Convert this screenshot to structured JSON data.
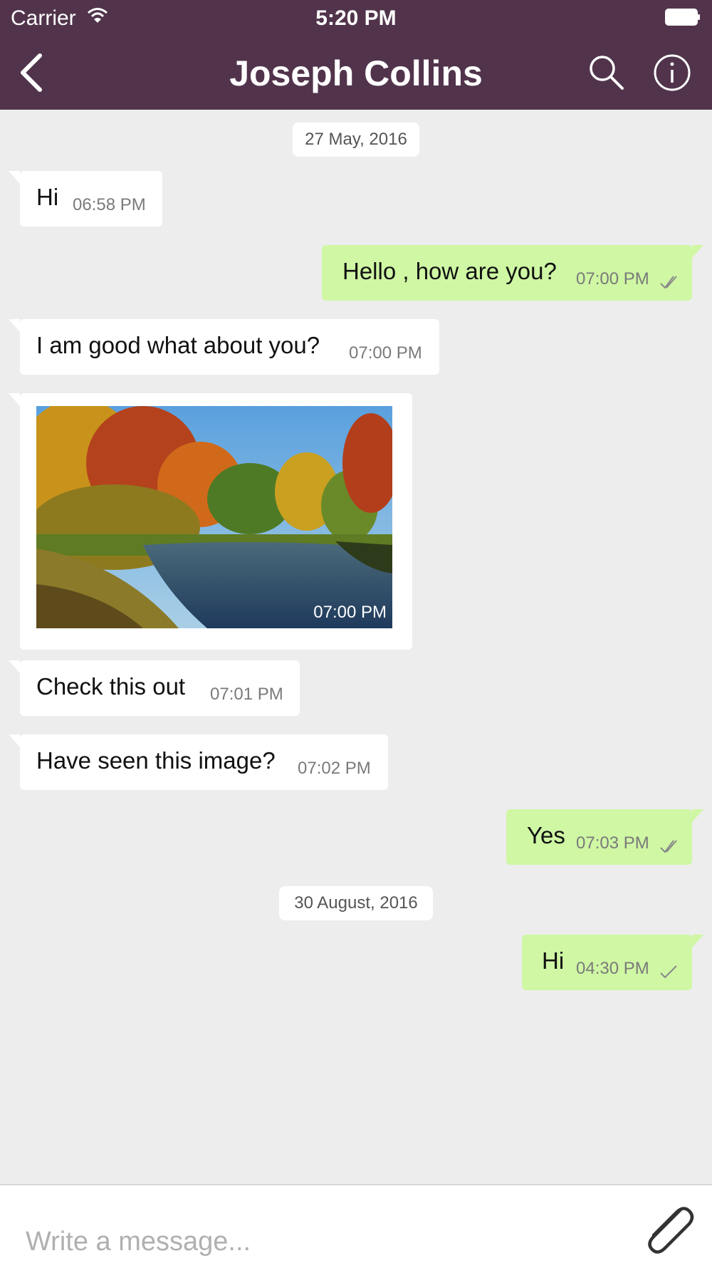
{
  "status_bar": {
    "carrier": "Carrier",
    "time": "5:20 PM"
  },
  "header": {
    "title": "Joseph Collins"
  },
  "icons": {
    "back": "chevron-left-icon",
    "search": "search-icon",
    "info": "info-icon",
    "attach": "paperclip-icon",
    "wifi": "wifi-icon",
    "battery": "battery-icon",
    "read_receipt": "double-check-icon",
    "sent_receipt": "check-icon"
  },
  "colors": {
    "header": "#51344b",
    "outgoing_bubble": "#cff7a4",
    "incoming_bubble": "#ffffff",
    "background": "#ededed"
  },
  "messages": [
    {
      "type": "date",
      "text": "27 May, 2016"
    },
    {
      "type": "in",
      "text": "Hi",
      "time": "06:58 PM"
    },
    {
      "type": "out",
      "text": "Hello , how are you?",
      "time": "07:00 PM",
      "status": "read"
    },
    {
      "type": "in",
      "text": "I am good what about you?",
      "time": "07:00 PM"
    },
    {
      "type": "in-image",
      "time": "07:00 PM"
    },
    {
      "type": "in",
      "text": "Check this out",
      "time": "07:01 PM"
    },
    {
      "type": "in",
      "text": "Have seen this image?",
      "time": "07:02 PM"
    },
    {
      "type": "out",
      "text": "Yes",
      "time": "07:03 PM",
      "status": "read"
    },
    {
      "type": "date",
      "text": "30 August, 2016"
    },
    {
      "type": "out",
      "text": "Hi",
      "time": "04:30 PM",
      "status": "sent"
    }
  ],
  "composer": {
    "placeholder": "Write a message..."
  }
}
